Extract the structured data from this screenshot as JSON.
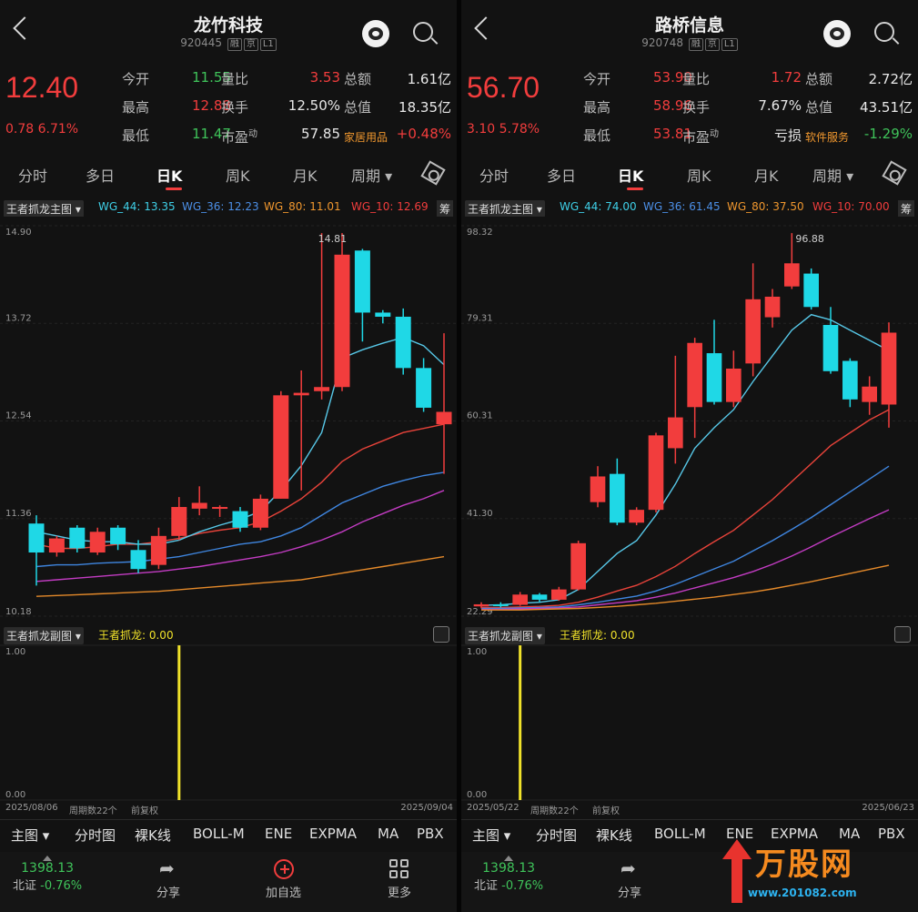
{
  "panels": [
    {
      "header": {
        "name": "龙竹科技",
        "code": "920445",
        "tags": [
          "融",
          "京",
          "L1"
        ]
      },
      "quote": {
        "price": "12.40",
        "change": "0.78",
        "change_pct": "6.71%",
        "rows": [
          [
            {
              "l": "今开",
              "v": "11.55",
              "c": "green"
            },
            {
              "l": "量比",
              "v": "3.53",
              "c": "red"
            },
            {
              "l": "总额",
              "v": "1.61亿",
              "c": "white"
            }
          ],
          [
            {
              "l": "最高",
              "v": "12.88",
              "c": "red"
            },
            {
              "l": "换手",
              "v": "12.50%",
              "c": "white"
            },
            {
              "l": "总值",
              "v": "18.35亿",
              "c": "white"
            }
          ],
          [
            {
              "l": "最低",
              "v": "11.47",
              "c": "green"
            },
            {
              "l": "市盈",
              "sup": "动",
              "v": "57.85",
              "c": "white"
            },
            {
              "l": "家居用品",
              "v": "+0.48%",
              "c": "red"
            }
          ]
        ]
      },
      "periods": [
        "分时",
        "多日",
        "日K",
        "周K",
        "月K",
        "周期"
      ],
      "active_period": "日K",
      "indicator": {
        "main_label": "王者抓龙主图",
        "wg44": "WG_44: 13.35",
        "wg36": "WG_36: 12.23",
        "wg80": "WG_80: 11.01",
        "wg10": "WG_10: 12.69",
        "chip": "筹"
      },
      "sub_indicator": {
        "label": "王者抓龙副图",
        "value": "王者抓龙: 0.00"
      },
      "dates": {
        "start": "2025/08/06",
        "periods": "周期数22个",
        "adj": "前复权",
        "end": "2025/09/04"
      },
      "chart_data": {
        "type": "candlestick",
        "y_ticks": [
          "14.90",
          "13.72",
          "12.54",
          "11.36",
          "10.18"
        ],
        "ylim": [
          10.18,
          14.9
        ],
        "high_label": "14.81",
        "candles": [
          {
            "o": 11.3,
            "c": 10.95,
            "h": 11.4,
            "l": 10.55
          },
          {
            "o": 10.95,
            "c": 11.12,
            "h": 11.15,
            "l": 10.9
          },
          {
            "o": 11.25,
            "c": 11.0,
            "h": 11.28,
            "l": 10.95
          },
          {
            "o": 10.95,
            "c": 11.2,
            "h": 11.25,
            "l": 10.92
          },
          {
            "o": 11.25,
            "c": 11.05,
            "h": 11.28,
            "l": 10.98
          },
          {
            "o": 10.98,
            "c": 10.75,
            "h": 11.1,
            "l": 10.7
          },
          {
            "o": 10.8,
            "c": 11.15,
            "h": 11.25,
            "l": 10.75
          },
          {
            "o": 11.15,
            "c": 11.5,
            "h": 11.62,
            "l": 11.1
          },
          {
            "o": 11.48,
            "c": 11.55,
            "h": 11.75,
            "l": 11.4
          },
          {
            "o": 11.5,
            "c": 11.5,
            "h": 11.52,
            "l": 11.38
          },
          {
            "o": 11.45,
            "c": 11.25,
            "h": 11.5,
            "l": 11.2
          },
          {
            "o": 11.25,
            "c": 11.6,
            "h": 11.65,
            "l": 11.22
          },
          {
            "o": 11.6,
            "c": 12.85,
            "h": 12.9,
            "l": 11.6
          },
          {
            "o": 12.85,
            "c": 12.88,
            "h": 13.15,
            "l": 11.7
          },
          {
            "o": 12.9,
            "c": 12.95,
            "h": 14.81,
            "l": 12.8
          },
          {
            "o": 12.95,
            "c": 14.55,
            "h": 14.81,
            "l": 12.9
          },
          {
            "o": 14.6,
            "c": 13.85,
            "h": 14.62,
            "l": 13.5
          },
          {
            "o": 13.85,
            "c": 13.8,
            "h": 13.88,
            "l": 13.72
          },
          {
            "o": 13.8,
            "c": 13.18,
            "h": 13.9,
            "l": 13.1
          },
          {
            "o": 13.18,
            "c": 12.7,
            "h": 13.3,
            "l": 12.65
          },
          {
            "o": 12.5,
            "c": 12.65,
            "h": 13.6,
            "l": 11.9
          }
        ],
        "lines": [
          {
            "name": "WG_10",
            "color": "#e8433a",
            "values": [
              11.05,
              11.0,
              11.0,
              11.02,
              11.05,
              11.05,
              11.08,
              11.12,
              11.18,
              11.22,
              11.25,
              11.32,
              11.45,
              11.6,
              11.8,
              12.05,
              12.2,
              12.3,
              12.4,
              12.45,
              12.5
            ]
          },
          {
            "name": "WG_44",
            "color": "#57c8e8",
            "values": [
              11.2,
              11.15,
              11.1,
              11.08,
              11.08,
              11.05,
              11.05,
              11.1,
              11.2,
              11.28,
              11.35,
              11.45,
              11.7,
              12.0,
              12.4,
              13.3,
              13.4,
              13.48,
              13.55,
              13.45,
              13.22
            ]
          },
          {
            "name": "WG_36",
            "color": "#3f86e0",
            "values": [
              10.78,
              10.8,
              10.8,
              10.82,
              10.83,
              10.84,
              10.87,
              10.9,
              10.95,
              11.0,
              11.05,
              11.08,
              11.15,
              11.25,
              11.4,
              11.55,
              11.65,
              11.75,
              11.82,
              11.88,
              11.92
            ]
          },
          {
            "name": "WG_80",
            "color": "#c33cc3",
            "values": [
              10.6,
              10.62,
              10.64,
              10.66,
              10.68,
              10.7,
              10.72,
              10.75,
              10.78,
              10.82,
              10.86,
              10.9,
              10.95,
              11.02,
              11.1,
              11.2,
              11.32,
              11.42,
              11.52,
              11.6,
              11.7
            ]
          },
          {
            "name": "base",
            "color": "#e58a2a",
            "values": [
              10.42,
              10.43,
              10.44,
              10.45,
              10.46,
              10.47,
              10.48,
              10.5,
              10.52,
              10.54,
              10.56,
              10.58,
              10.6,
              10.62,
              10.66,
              10.7,
              10.74,
              10.78,
              10.82,
              10.86,
              10.9
            ]
          }
        ],
        "sub": {
          "ylim": [
            0,
            1.0
          ],
          "y_ticks": [
            "1.00",
            "0.00"
          ],
          "bar_index": 7
        }
      }
    },
    {
      "header": {
        "name": "路桥信息",
        "code": "920748",
        "tags": [
          "融",
          "京",
          "L1"
        ]
      },
      "quote": {
        "price": "56.70",
        "change": "3.10",
        "change_pct": "5.78%",
        "rows": [
          [
            {
              "l": "今开",
              "v": "53.90",
              "c": "red"
            },
            {
              "l": "量比",
              "v": "1.72",
              "c": "red"
            },
            {
              "l": "总额",
              "v": "2.72亿",
              "c": "white"
            }
          ],
          [
            {
              "l": "最高",
              "v": "58.96",
              "c": "red"
            },
            {
              "l": "换手",
              "v": "7.67%",
              "c": "white"
            },
            {
              "l": "总值",
              "v": "43.51亿",
              "c": "white"
            }
          ],
          [
            {
              "l": "最低",
              "v": "53.81",
              "c": "red"
            },
            {
              "l": "市盈",
              "sup": "动",
              "v": "亏损",
              "c": "white"
            },
            {
              "l": "软件服务",
              "v": "-1.29%",
              "c": "green"
            }
          ]
        ]
      },
      "periods": [
        "分时",
        "多日",
        "日K",
        "周K",
        "月K",
        "周期"
      ],
      "active_period": "日K",
      "indicator": {
        "main_label": "王者抓龙主图",
        "wg44": "WG_44: 74.00",
        "wg36": "WG_36: 61.45",
        "wg80": "WG_80: 37.50",
        "wg10": "WG_10: 70.00",
        "chip": "筹"
      },
      "sub_indicator": {
        "label": "王者抓龙副图",
        "value": "王者抓龙: 0.00"
      },
      "dates": {
        "start": "2025/05/22",
        "periods": "周期数22个",
        "adj": "前复权",
        "end": "2025/06/23"
      },
      "chart_data": {
        "type": "candlestick",
        "y_ticks": [
          "98.32",
          "79.31",
          "60.31",
          "41.30",
          "22.29"
        ],
        "ylim": [
          22.29,
          98.32
        ],
        "high_label": "96.88",
        "candles": [
          {
            "o": 24.2,
            "c": 24.6,
            "h": 25.0,
            "l": 23.8
          },
          {
            "o": 24.6,
            "c": 24.3,
            "h": 25.0,
            "l": 24.0
          },
          {
            "o": 24.5,
            "c": 26.5,
            "h": 27.0,
            "l": 24.3
          },
          {
            "o": 26.5,
            "c": 25.5,
            "h": 26.8,
            "l": 25.0
          },
          {
            "o": 25.5,
            "c": 27.5,
            "h": 28.0,
            "l": 25.3
          },
          {
            "o": 27.5,
            "c": 36.5,
            "h": 37.0,
            "l": 27.3
          },
          {
            "o": 44.5,
            "c": 49.5,
            "h": 51.5,
            "l": 43.5
          },
          {
            "o": 50.0,
            "c": 40.5,
            "h": 53.0,
            "l": 40.0
          },
          {
            "o": 40.5,
            "c": 43.0,
            "h": 43.5,
            "l": 40.0
          },
          {
            "o": 43.0,
            "c": 57.5,
            "h": 58.0,
            "l": 42.5
          },
          {
            "o": 55.0,
            "c": 61.0,
            "h": 73.0,
            "l": 52.0
          },
          {
            "o": 63.0,
            "c": 75.5,
            "h": 76.5,
            "l": 57.0
          },
          {
            "o": 73.5,
            "c": 64.0,
            "h": 80.0,
            "l": 63.5
          },
          {
            "o": 64.0,
            "c": 70.5,
            "h": 74.0,
            "l": 63.0
          },
          {
            "o": 71.5,
            "c": 84.0,
            "h": 91.0,
            "l": 69.0
          },
          {
            "o": 80.5,
            "c": 84.5,
            "h": 86.0,
            "l": 78.5
          },
          {
            "o": 86.5,
            "c": 91.0,
            "h": 96.88,
            "l": 86.0
          },
          {
            "o": 89.0,
            "c": 82.5,
            "h": 90.0,
            "l": 82.0
          },
          {
            "o": 79.0,
            "c": 70.0,
            "h": 82.5,
            "l": 69.5
          },
          {
            "o": 72.0,
            "c": 64.5,
            "h": 72.5,
            "l": 63.0
          },
          {
            "o": 64.0,
            "c": 67.0,
            "h": 69.0,
            "l": 61.5
          },
          {
            "o": 63.5,
            "c": 77.5,
            "h": 79.5,
            "l": 59.0
          }
        ],
        "lines": [
          {
            "name": "WG_44",
            "color": "#57c8e8",
            "values": [
              24.4,
              24.5,
              24.8,
              25.0,
              25.5,
              27.5,
              31.0,
              34.5,
              37.0,
              42.0,
              48.0,
              55.0,
              59.0,
              62.5,
              68.0,
              73.0,
              78.0,
              81.0,
              80.0,
              78.0,
              76.0,
              74.0
            ]
          },
          {
            "name": "WG_10",
            "color": "#e8433a",
            "values": [
              24.0,
              24.0,
              24.1,
              24.2,
              24.4,
              25.0,
              26.0,
              27.2,
              28.3,
              30.0,
              32.0,
              34.5,
              36.8,
              39.0,
              42.0,
              45.0,
              48.5,
              52.0,
              55.5,
              58.0,
              60.5,
              62.5
            ]
          },
          {
            "name": "WG_36",
            "color": "#3f86e0",
            "values": [
              23.8,
              23.8,
              23.9,
              24.0,
              24.1,
              24.5,
              25.0,
              25.6,
              26.2,
              27.2,
              28.5,
              30.0,
              31.5,
              33.0,
              35.0,
              37.0,
              39.2,
              41.5,
              44.0,
              46.5,
              49.0,
              51.5
            ]
          },
          {
            "name": "WG_80",
            "color": "#c33cc3",
            "values": [
              23.6,
              23.6,
              23.7,
              23.8,
              23.9,
              24.1,
              24.5,
              24.9,
              25.3,
              26.0,
              26.8,
              27.8,
              28.8,
              29.8,
              31.0,
              32.4,
              34.0,
              35.8,
              37.7,
              39.5,
              41.3,
              43.0
            ]
          },
          {
            "name": "base",
            "color": "#e58a2a",
            "values": [
              23.5,
              23.5,
              23.5,
              23.6,
              23.7,
              23.8,
              24.0,
              24.2,
              24.5,
              24.8,
              25.2,
              25.6,
              26.0,
              26.5,
              27.0,
              27.6,
              28.3,
              29.0,
              29.8,
              30.6,
              31.4,
              32.2
            ]
          }
        ],
        "sub": {
          "ylim": [
            0,
            1.0
          ],
          "y_ticks": [
            "1.00",
            "0.00"
          ],
          "bar_index": 2
        }
      }
    }
  ],
  "toolbar": [
    "主图",
    "分时图",
    "裸K线",
    "BOLL-M",
    "ENE",
    "EXPMA",
    "MA",
    "PBX"
  ],
  "bottom": {
    "index_value": "1398.13",
    "index_name": "北证",
    "index_change": "-0.76%",
    "share": "分享",
    "add": "加自选",
    "more": "更多"
  },
  "watermark": {
    "brand": "万股网",
    "url": "www.201082.com"
  },
  "colors": {
    "up": "#f23d3d",
    "down": "#1fd8e6",
    "bg": "#121212"
  }
}
